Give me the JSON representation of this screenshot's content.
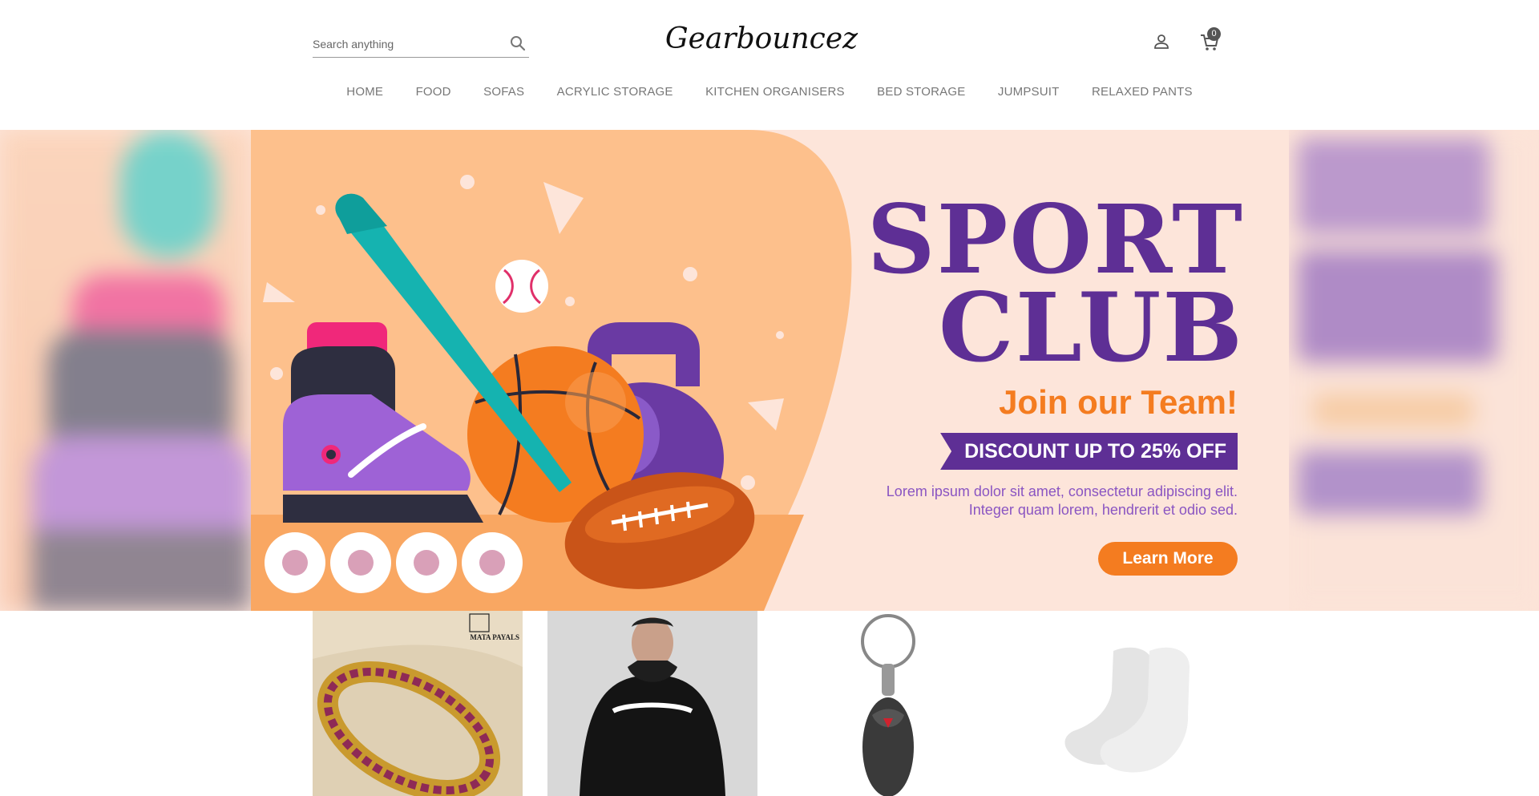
{
  "header": {
    "search_placeholder": "Search anything",
    "logo": "Gearbouncez",
    "cart_count": "0"
  },
  "nav": {
    "items": [
      "HOME",
      "FOOD",
      "SOFAS",
      "ACRYLIC STORAGE",
      "KITCHEN ORGANISERS",
      "BED STORAGE",
      "JUMPSUIT",
      "RELAXED PANTS"
    ]
  },
  "hero": {
    "title_line1": "SPORT",
    "title_line2": "CLUB",
    "subtitle": "Join our Team!",
    "discount": "DISCOUNT UP TO 25% OFF",
    "description": "Lorem ipsum dolor sit amet, consectetur adipiscing elit. Integer quam lorem, hendrerit et odio sed.",
    "cta": "Learn More",
    "colors": {
      "purple": "#5e2f95",
      "orange": "#f47c20",
      "peach": "#fde5da"
    }
  },
  "products": [
    {
      "name": "bangle",
      "brand_line1": "MATA PAYALS"
    },
    {
      "name": "hoodie"
    },
    {
      "name": "keychain"
    },
    {
      "name": "socks"
    }
  ]
}
